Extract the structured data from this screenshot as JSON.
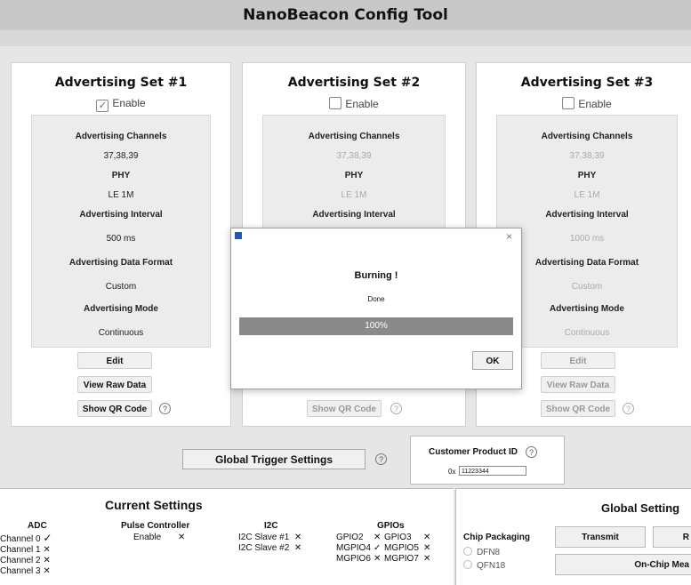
{
  "window": {
    "title": "NanoBeacon Config Tool"
  },
  "sets": [
    {
      "title": "Advertising Set #1",
      "enable_label": "Enable",
      "enabled": true,
      "channels_label": "Advertising Channels",
      "channels_value": "37,38,39",
      "phy_label": "PHY",
      "phy_value": "LE 1M",
      "interval_label": "Advertising Interval",
      "interval_value": "500 ms",
      "format_label": "Advertising Data Format",
      "format_value": "Custom",
      "mode_label": "Advertising Mode",
      "mode_value": "Continuous",
      "edit_label": "Edit",
      "raw_label": "View Raw Data",
      "qr_label": "Show QR Code",
      "help_icon": "?"
    },
    {
      "title": "Advertising Set #2",
      "enable_label": "Enable",
      "enabled": false,
      "channels_label": "Advertising Channels",
      "channels_value": "37,38,39",
      "phy_label": "PHY",
      "phy_value": "LE 1M",
      "interval_label": "Advertising Interval",
      "qr_label": "Show QR Code",
      "help_icon": "?"
    },
    {
      "title": "Advertising Set #3",
      "enable_label": "Enable",
      "enabled": false,
      "channels_label": "Advertising Channels",
      "channels_value": "37,38,39",
      "phy_label": "PHY",
      "phy_value": "LE 1M",
      "interval_label": "Advertising Interval",
      "interval_value": "1000 ms",
      "format_label": "Advertising Data Format",
      "format_value": "Custom",
      "mode_label": "Advertising Mode",
      "mode_value": "Continuous",
      "edit_label": "Edit",
      "raw_label": "View Raw Data",
      "qr_label": "Show QR Code",
      "help_icon": "?"
    }
  ],
  "dialog": {
    "title": "Burning !",
    "message": "Done",
    "progress": 100,
    "progress_text": "100%",
    "ok_label": "OK",
    "close_glyph": "×"
  },
  "global_trigger": {
    "label": "Global Trigger Settings",
    "help_icon": "?"
  },
  "customer_product": {
    "label": "Customer Product ID",
    "prefix": "0x",
    "value": "11223344",
    "help_icon": "?"
  },
  "current_settings": {
    "title": "Current Settings",
    "adc": {
      "header": "ADC",
      "rows": [
        {
          "label": "Channel 0",
          "mark": "✓"
        },
        {
          "label": "Channel 1",
          "mark": "✕"
        },
        {
          "label": "Channel 2",
          "mark": "✕"
        },
        {
          "label": "Channel 3",
          "mark": "✕"
        }
      ]
    },
    "pulse": {
      "header": "Pulse Controller",
      "label": "Enable",
      "mark": "✕"
    },
    "i2c": {
      "header": "I2C",
      "rows": [
        {
          "label": "I2C Slave #1",
          "mark": "✕"
        },
        {
          "label": "I2C Slave #2",
          "mark": "✕"
        }
      ]
    },
    "gpios": {
      "header": "GPIOs",
      "rows": [
        {
          "a": "GPIO2",
          "am": "✕",
          "b": "GPIO3",
          "bm": "✕"
        },
        {
          "a": "MGPIO4",
          "am": "✓",
          "b": "MGPIO5",
          "bm": "✕"
        },
        {
          "a": "MGPIO6",
          "am": "✕",
          "b": "MGPIO7",
          "bm": "✕"
        }
      ]
    }
  },
  "global_settings": {
    "title": "Global Setting",
    "chip_packaging_label": "Chip Packaging",
    "options": [
      "DFN8",
      "QFN18"
    ],
    "transmit_label": "Transmit",
    "next_label": "R",
    "on_chip_label": "On-Chip Mea"
  }
}
